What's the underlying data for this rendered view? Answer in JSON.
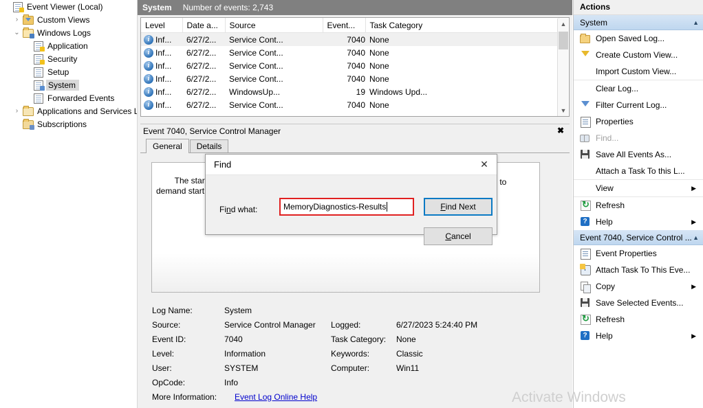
{
  "tree": {
    "items": [
      {
        "label": "Event Viewer (Local)",
        "indent": 0,
        "twisty": "",
        "icon": "event-viewer-icon",
        "selected": false
      },
      {
        "label": "Custom Views",
        "indent": 1,
        "twisty": "›",
        "icon": "custom-views-folder-icon",
        "selected": false
      },
      {
        "label": "Windows Logs",
        "indent": 1,
        "twisty": "⌄",
        "icon": "windows-logs-folder-icon",
        "selected": false
      },
      {
        "label": "Application",
        "indent": 2,
        "twisty": "",
        "icon": "application-log-icon",
        "selected": false
      },
      {
        "label": "Security",
        "indent": 2,
        "twisty": "",
        "icon": "security-log-icon",
        "selected": false
      },
      {
        "label": "Setup",
        "indent": 2,
        "twisty": "",
        "icon": "setup-log-icon",
        "selected": false
      },
      {
        "label": "System",
        "indent": 2,
        "twisty": "",
        "icon": "system-log-icon",
        "selected": true
      },
      {
        "label": "Forwarded Events",
        "indent": 2,
        "twisty": "",
        "icon": "forwarded-events-log-icon",
        "selected": false
      },
      {
        "label": "Applications and Services Lo",
        "indent": 1,
        "twisty": "›",
        "icon": "app-services-folder-icon",
        "selected": false
      },
      {
        "label": "Subscriptions",
        "indent": 1,
        "twisty": "",
        "icon": "subscriptions-icon",
        "selected": false
      }
    ]
  },
  "log_header": {
    "title": "System",
    "count_text": "Number of events: 2,743"
  },
  "event_list": {
    "columns": [
      "Level",
      "Date a...",
      "Source",
      "Event...",
      "Task Category"
    ],
    "rows": [
      {
        "level": "Inf...",
        "date": "6/27/2...",
        "source": "Service Cont...",
        "event_id": "7040",
        "task": "None",
        "selected": true
      },
      {
        "level": "Inf...",
        "date": "6/27/2...",
        "source": "Service Cont...",
        "event_id": "7040",
        "task": "None",
        "selected": false
      },
      {
        "level": "Inf...",
        "date": "6/27/2...",
        "source": "Service Cont...",
        "event_id": "7040",
        "task": "None",
        "selected": false
      },
      {
        "level": "Inf...",
        "date": "6/27/2...",
        "source": "Service Cont...",
        "event_id": "7040",
        "task": "None",
        "selected": false
      },
      {
        "level": "Inf...",
        "date": "6/27/2...",
        "source": "WindowsUp...",
        "event_id": "19",
        "task": "Windows Upd...",
        "selected": false
      },
      {
        "level": "Inf...",
        "date": "6/27/2...",
        "source": "Service Cont...",
        "event_id": "7040",
        "task": "None",
        "selected": false
      }
    ]
  },
  "detail": {
    "header_title": "Event 7040, Service Control Manager",
    "close_label": "✖",
    "tabs": [
      {
        "label": "General",
        "active": true
      },
      {
        "label": "Details",
        "active": false
      }
    ],
    "description_left": "The start type\ndemand start",
    "description_right": "art to",
    "meta": [
      {
        "label1": "Log Name:",
        "value1": "System",
        "label2": "",
        "value2": ""
      },
      {
        "label1": "Source:",
        "value1": "Service Control Manager",
        "label2": "Logged:",
        "value2": "6/27/2023 5:24:40 PM"
      },
      {
        "label1": "Event ID:",
        "value1": "7040",
        "label2": "Task Category:",
        "value2": "None"
      },
      {
        "label1": "Level:",
        "value1": "Information",
        "label2": "Keywords:",
        "value2": "Classic"
      },
      {
        "label1": "User:",
        "value1": "SYSTEM",
        "label2": "Computer:",
        "value2": "Win11"
      },
      {
        "label1": "OpCode:",
        "value1": "Info",
        "label2": "",
        "value2": ""
      }
    ],
    "more_info_label": "More Information:",
    "more_info_link": "Event Log Online Help"
  },
  "actions": {
    "title": "Actions",
    "groups": [
      {
        "name": "System",
        "chevron": "▲",
        "items": [
          {
            "label": "Open Saved Log...",
            "icon": "open-folder-icon",
            "disabled": false,
            "submenu": false,
            "separator": false
          },
          {
            "label": "Create Custom View...",
            "icon": "funnel-yellow-icon",
            "disabled": false,
            "submenu": false,
            "separator": false
          },
          {
            "label": "Import Custom View...",
            "icon": "",
            "disabled": false,
            "submenu": false,
            "separator": false
          },
          {
            "label": "Clear Log...",
            "icon": "",
            "disabled": false,
            "submenu": false,
            "separator": true
          },
          {
            "label": "Filter Current Log...",
            "icon": "funnel-blue-icon",
            "disabled": false,
            "submenu": false,
            "separator": false
          },
          {
            "label": "Properties",
            "icon": "properties-icon",
            "disabled": false,
            "submenu": false,
            "separator": false
          },
          {
            "label": "Find...",
            "icon": "binoculars-icon",
            "disabled": true,
            "submenu": false,
            "separator": false
          },
          {
            "label": "Save All Events As...",
            "icon": "save-icon",
            "disabled": false,
            "submenu": false,
            "separator": false
          },
          {
            "label": "Attach a Task To this L...",
            "icon": "",
            "disabled": false,
            "submenu": false,
            "separator": false
          },
          {
            "label": "View",
            "icon": "",
            "disabled": false,
            "submenu": true,
            "separator": true
          },
          {
            "label": "Refresh",
            "icon": "refresh-icon",
            "disabled": false,
            "submenu": false,
            "separator": true
          },
          {
            "label": "Help",
            "icon": "help-icon",
            "disabled": false,
            "submenu": true,
            "separator": false
          }
        ]
      },
      {
        "name": "Event 7040, Service Control ...",
        "chevron": "▲",
        "items": [
          {
            "label": "Event Properties",
            "icon": "properties-icon",
            "disabled": false,
            "submenu": false,
            "separator": false
          },
          {
            "label": "Attach Task To This Eve...",
            "icon": "attach-task-icon",
            "disabled": false,
            "submenu": false,
            "separator": false
          },
          {
            "label": "Copy",
            "icon": "copy-icon",
            "disabled": false,
            "submenu": true,
            "separator": false
          },
          {
            "label": "Save Selected Events...",
            "icon": "save-icon",
            "disabled": false,
            "submenu": false,
            "separator": false
          },
          {
            "label": "Refresh",
            "icon": "refresh-icon",
            "disabled": false,
            "submenu": false,
            "separator": false
          },
          {
            "label": "Help",
            "icon": "help-icon",
            "disabled": false,
            "submenu": true,
            "separator": false
          }
        ]
      }
    ],
    "submenu_arrow": "▶"
  },
  "find_dialog": {
    "title": "Find",
    "close_label": "✕",
    "field_label_pre": "Fi",
    "field_label_accel": "n",
    "field_label_post": "d what:",
    "field_value": "MemoryDiagnostics-Results",
    "find_next_pre": "",
    "find_next_accel": "F",
    "find_next_post": "ind Next",
    "cancel_accel": "C",
    "cancel_post": "ancel",
    "highlight_color": "#e02020",
    "focus_color": "#0b7ac4"
  },
  "watermark": {
    "text": "Activate Windows"
  }
}
